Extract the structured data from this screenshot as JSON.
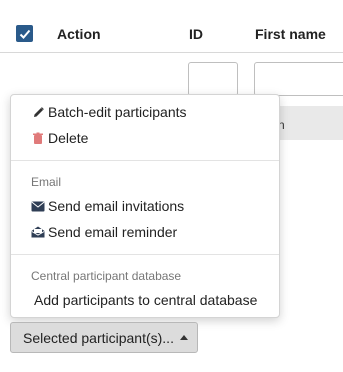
{
  "table": {
    "columns": [
      {
        "label": "Action"
      },
      {
        "label": "ID"
      },
      {
        "label": "First name"
      }
    ],
    "row_button_partial": "n"
  },
  "menu": {
    "items": {
      "batch_edit": "Batch-edit participants",
      "delete": "Delete",
      "email_header": "Email",
      "send_invitations": "Send email invitations",
      "send_reminder": "Send email reminder",
      "cpdb_header": "Central participant database",
      "add_to_cpdb": "Add participants to central database"
    }
  },
  "selected_button": {
    "label": "Selected participant(s)..."
  },
  "colors": {
    "checkbox": "#2a5a8a",
    "delete_icon": "#e07a7a",
    "menu_header": "#777777"
  }
}
